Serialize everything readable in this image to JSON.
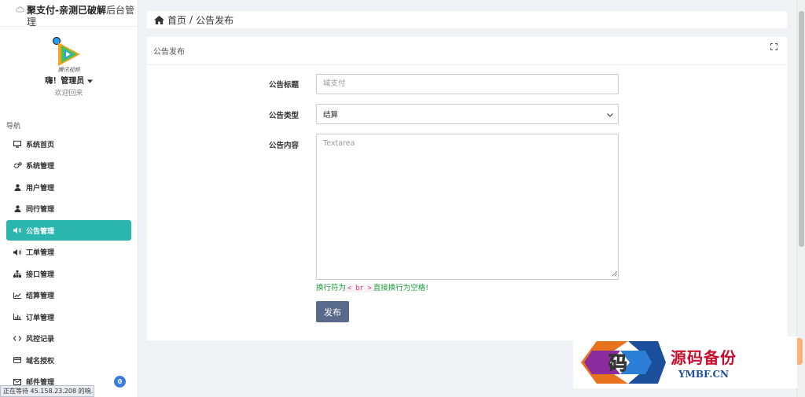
{
  "brand": {
    "bold": "聚支付-亲测已破解",
    "rest": "后台管理"
  },
  "user": {
    "logo_text": "腾讯视频",
    "greeting": "嗨！管理员",
    "welcome": "欢迎回来"
  },
  "nav": {
    "heading": "导航",
    "items": [
      {
        "label": "系统首页",
        "icon": "monitor-icon"
      },
      {
        "label": "系统管理",
        "icon": "cogs-icon"
      },
      {
        "label": "用户管理",
        "icon": "user-icon"
      },
      {
        "label": "同行管理",
        "icon": "user-icon"
      },
      {
        "label": "公告管理",
        "icon": "megaphone-icon",
        "active": true
      },
      {
        "label": "工单管理",
        "icon": "megaphone-icon"
      },
      {
        "label": "接口管理",
        "icon": "sitemap-icon"
      },
      {
        "label": "结算管理",
        "icon": "line-chart-icon"
      },
      {
        "label": "订单管理",
        "icon": "bar-chart-icon"
      },
      {
        "label": "风控记录",
        "icon": "code-icon"
      },
      {
        "label": "域名授权",
        "icon": "card-icon"
      },
      {
        "label": "邮件管理",
        "icon": "mail-icon",
        "badge": "0"
      }
    ]
  },
  "breadcrumb": {
    "home": "首页",
    "separator": "/",
    "current": "公告发布"
  },
  "card": {
    "title": "公告发布"
  },
  "form": {
    "title_label": "公告标题",
    "title_placeholder": "域支付",
    "type_label": "公告类型",
    "type_value": "结算",
    "content_label": "公告内容",
    "content_placeholder": "Textarea",
    "hint_before": "换行符为",
    "hint_code": "< br >",
    "hint_after": "直接换行为空格!",
    "submit": "发布"
  },
  "watermark": {
    "title": "源码备份",
    "url": "YMBF.CN",
    "mark": "码"
  },
  "status_text": "正在等待 45.158.23.208 的响...",
  "colors": {
    "accent": "#2bb6b0",
    "button": "#5a6a8c",
    "badge": "#3b7dd8",
    "hint": "#1a9a3a"
  }
}
